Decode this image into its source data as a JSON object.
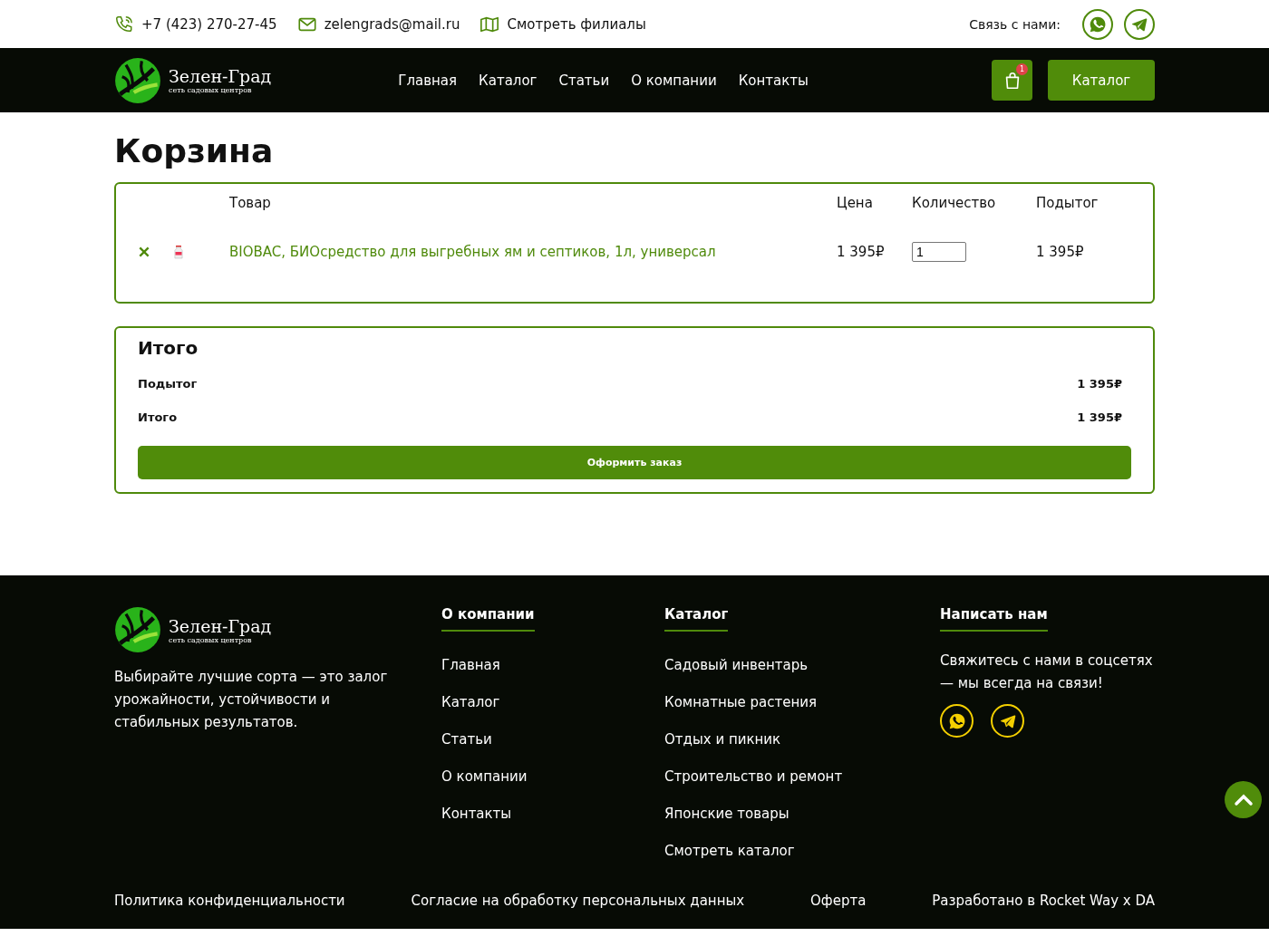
{
  "topbar": {
    "phone": "+7 (423) 270-27-45",
    "email": "zelengrads@mail.ru",
    "branches": "Смотреть филиалы",
    "contact_label": "Связь с нами:"
  },
  "header": {
    "logo": {
      "name": "Зелен-Град",
      "tagline": "сеть садовых центров"
    },
    "nav": [
      "Главная",
      "Каталог",
      "Статьи",
      "О компании",
      "Контакты"
    ],
    "cart_count": "1",
    "catalog_button": "Каталог"
  },
  "cart": {
    "title": "Корзина",
    "columns": [
      "Товар",
      "Цена",
      "Количество",
      "Подытог"
    ],
    "rows": [
      {
        "name": "BIOBAC, БИОсредство для выгребных ям и септиков, 1л, универсал",
        "price": "1 395₽",
        "quantity": "1",
        "subtotal": "1 395₽"
      }
    ]
  },
  "totals": {
    "title": "Итого",
    "lines": [
      {
        "label": "Подытог",
        "value": "1 395₽"
      },
      {
        "label": "Итого",
        "value": "1 395₽"
      }
    ],
    "checkout_button": "Оформить заказ"
  },
  "footer": {
    "logo": {
      "name": "Зелен-Град",
      "tagline": "сеть садовых центров"
    },
    "description": "Выбирайте лучшие сорта — это залог урожайности, устойчивости и стабильных результатов.",
    "columns": [
      {
        "title": "О компании",
        "links": [
          "Главная",
          "Каталог",
          "Статьи",
          "О компании",
          "Контакты"
        ]
      },
      {
        "title": "Каталог",
        "links": [
          "Садовый инвентарь",
          "Комнатные растения",
          "Отдых и пикник",
          "Строительство и ремонт",
          "Японские товары",
          "Смотреть каталог"
        ]
      }
    ],
    "write": {
      "title": "Написать нам",
      "text": "Свяжитесь с нами в соцсетях — мы всегда на связи!"
    },
    "bottom_links": [
      "Политика конфиденциальности",
      "Согласие на обработку персональных данных",
      "Оферта"
    ],
    "credit": "Разработано в Rocket Way x DA"
  }
}
